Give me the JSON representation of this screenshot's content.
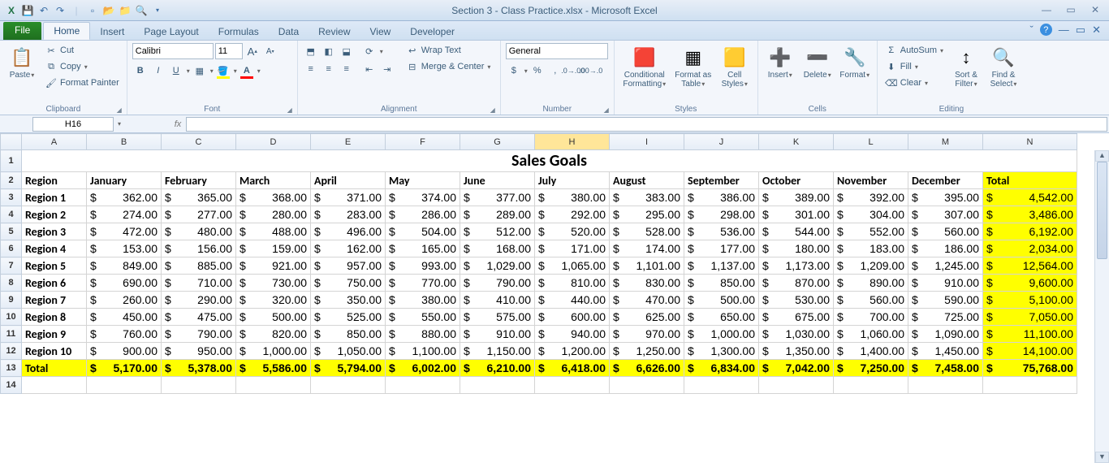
{
  "title": "Section 3 - Class Practice.xlsx - Microsoft Excel",
  "tabs": {
    "file": "File",
    "home": "Home",
    "insert": "Insert",
    "page": "Page Layout",
    "formulas": "Formulas",
    "data": "Data",
    "review": "Review",
    "view": "View",
    "dev": "Developer"
  },
  "clipboard": {
    "paste": "Paste",
    "cut": "Cut",
    "copy": "Copy",
    "fmt": "Format Painter",
    "label": "Clipboard"
  },
  "font": {
    "name": "Calibri",
    "size": "11",
    "label": "Font",
    "bold": "B",
    "italic": "I",
    "underline": "U"
  },
  "align": {
    "label": "Alignment",
    "wrap": "Wrap Text",
    "merge": "Merge & Center"
  },
  "number": {
    "label": "Number",
    "format": "General",
    "cur": "$",
    "pct": "%",
    "comma": ","
  },
  "styles": {
    "label": "Styles",
    "cond": "Conditional Formatting",
    "fmt": "Format as Table",
    "cell": "Cell Styles"
  },
  "cells": {
    "label": "Cells",
    "ins": "Insert",
    "del": "Delete",
    "fmt": "Format"
  },
  "editing": {
    "label": "Editing",
    "sum": "AutoSum",
    "fill": "Fill",
    "clear": "Clear",
    "sort": "Sort & Filter",
    "find": "Find & Select"
  },
  "namebox": "H16",
  "cols": [
    "A",
    "B",
    "C",
    "D",
    "E",
    "F",
    "G",
    "H",
    "I",
    "J",
    "K",
    "L",
    "M",
    "N"
  ],
  "selCol": "H",
  "sheetTitle": "Sales Goals",
  "months": [
    "January",
    "February",
    "March",
    "April",
    "May",
    "June",
    "July",
    "August",
    "September",
    "October",
    "November",
    "December"
  ],
  "hdrRegion": "Region",
  "hdrTotal": "Total",
  "rows": [
    {
      "r": "Region 1",
      "v": [
        "362.00",
        "365.00",
        "368.00",
        "371.00",
        "374.00",
        "377.00",
        "380.00",
        "383.00",
        "386.00",
        "389.00",
        "392.00",
        "395.00"
      ],
      "t": "4,542.00"
    },
    {
      "r": "Region 2",
      "v": [
        "274.00",
        "277.00",
        "280.00",
        "283.00",
        "286.00",
        "289.00",
        "292.00",
        "295.00",
        "298.00",
        "301.00",
        "304.00",
        "307.00"
      ],
      "t": "3,486.00"
    },
    {
      "r": "Region 3",
      "v": [
        "472.00",
        "480.00",
        "488.00",
        "496.00",
        "504.00",
        "512.00",
        "520.00",
        "528.00",
        "536.00",
        "544.00",
        "552.00",
        "560.00"
      ],
      "t": "6,192.00"
    },
    {
      "r": "Region 4",
      "v": [
        "153.00",
        "156.00",
        "159.00",
        "162.00",
        "165.00",
        "168.00",
        "171.00",
        "174.00",
        "177.00",
        "180.00",
        "183.00",
        "186.00"
      ],
      "t": "2,034.00"
    },
    {
      "r": "Region 5",
      "v": [
        "849.00",
        "885.00",
        "921.00",
        "957.00",
        "993.00",
        "1,029.00",
        "1,065.00",
        "1,101.00",
        "1,137.00",
        "1,173.00",
        "1,209.00",
        "1,245.00"
      ],
      "t": "12,564.00"
    },
    {
      "r": "Region 6",
      "v": [
        "690.00",
        "710.00",
        "730.00",
        "750.00",
        "770.00",
        "790.00",
        "810.00",
        "830.00",
        "850.00",
        "870.00",
        "890.00",
        "910.00"
      ],
      "t": "9,600.00"
    },
    {
      "r": "Region 7",
      "v": [
        "260.00",
        "290.00",
        "320.00",
        "350.00",
        "380.00",
        "410.00",
        "440.00",
        "470.00",
        "500.00",
        "530.00",
        "560.00",
        "590.00"
      ],
      "t": "5,100.00"
    },
    {
      "r": "Region 8",
      "v": [
        "450.00",
        "475.00",
        "500.00",
        "525.00",
        "550.00",
        "575.00",
        "600.00",
        "625.00",
        "650.00",
        "675.00",
        "700.00",
        "725.00"
      ],
      "t": "7,050.00"
    },
    {
      "r": "Region 9",
      "v": [
        "760.00",
        "790.00",
        "820.00",
        "850.00",
        "880.00",
        "910.00",
        "940.00",
        "970.00",
        "1,000.00",
        "1,030.00",
        "1,060.00",
        "1,090.00"
      ],
      "t": "11,100.00"
    },
    {
      "r": "Region 10",
      "v": [
        "900.00",
        "950.00",
        "1,000.00",
        "1,050.00",
        "1,100.00",
        "1,150.00",
        "1,200.00",
        "1,250.00",
        "1,300.00",
        "1,350.00",
        "1,400.00",
        "1,450.00"
      ],
      "t": "14,100.00"
    }
  ],
  "totalRow": {
    "r": "Total",
    "v": [
      "5,170.00",
      "5,378.00",
      "5,586.00",
      "5,794.00",
      "6,002.00",
      "6,210.00",
      "6,418.00",
      "6,626.00",
      "6,834.00",
      "7,042.00",
      "7,250.00",
      "7,458.00"
    ],
    "t": "75,768.00"
  }
}
